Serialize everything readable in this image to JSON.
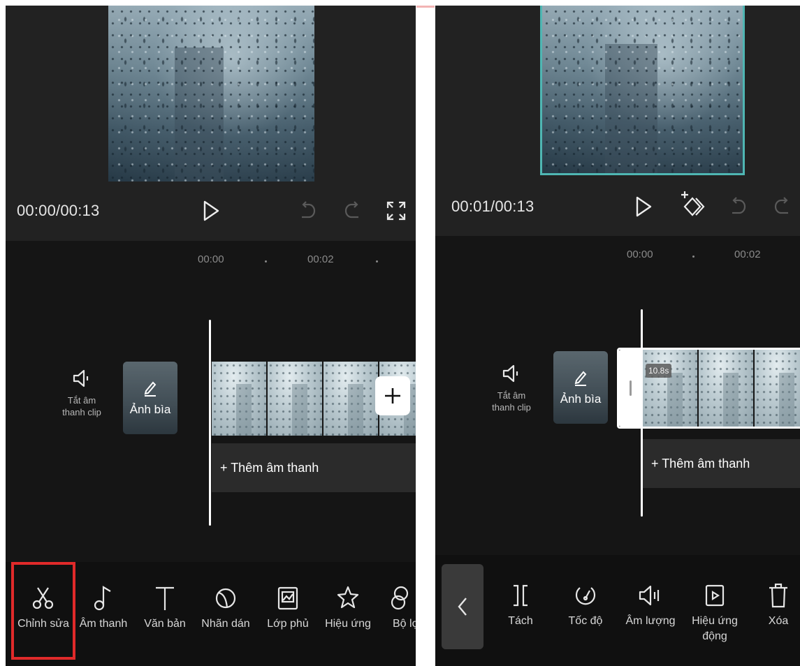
{
  "left": {
    "time": "00:00/00:13",
    "ruler": [
      "00:00",
      "00:02"
    ],
    "mute_label_line1": "Tắt âm",
    "mute_label_line2": "thanh clip",
    "cover_label": "Ảnh bìa",
    "add_audio_label": "+ Thêm âm thanh",
    "tools": [
      {
        "label": "Chỉnh sửa",
        "icon": "scissors-icon"
      },
      {
        "label": "Âm thanh",
        "icon": "music-note-icon"
      },
      {
        "label": "Văn bản",
        "icon": "text-icon"
      },
      {
        "label": "Nhãn dán",
        "icon": "sticker-icon"
      },
      {
        "label": "Lớp phủ",
        "icon": "overlay-icon"
      },
      {
        "label": "Hiệu ứng",
        "icon": "effects-star-icon"
      },
      {
        "label": "Bộ lọ",
        "icon": "filter-icon"
      }
    ],
    "highlighted_tool": "Chỉnh sửa"
  },
  "right": {
    "time": "00:01/00:13",
    "ruler": [
      "00:00",
      "00:02"
    ],
    "mute_label_line1": "Tắt âm",
    "mute_label_line2": "thanh clip",
    "cover_label": "Ảnh bìa",
    "clip_duration": "10.8s",
    "add_audio_label": "+ Thêm âm thanh",
    "tools": [
      {
        "label": "Tách",
        "icon": "split-icon"
      },
      {
        "label": "Tốc độ",
        "icon": "speed-icon"
      },
      {
        "label": "Âm lượng",
        "icon": "volume-icon"
      },
      {
        "label": "Hiệu ứng",
        "label2": "động",
        "icon": "animation-icon"
      },
      {
        "label": "Xóa",
        "icon": "trash-icon"
      }
    ]
  },
  "colors": {
    "panel_bg": "#222222",
    "timeline_bg": "#151515",
    "toolbar_bg": "#101010",
    "highlight": "#e02a2a",
    "selected_frame": "#4fb6b3"
  }
}
